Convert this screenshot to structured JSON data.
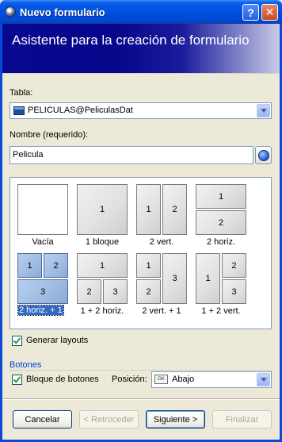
{
  "window": {
    "title": "Nuevo formulario",
    "help_label": "?",
    "close_label": "✕"
  },
  "banner": {
    "text": "Asistente para la creación de formulario"
  },
  "table": {
    "label": "Tabla:",
    "value": "PELICULAS@PeliculasDat",
    "icon": "table-icon"
  },
  "name": {
    "label": "Nombre (requerido):",
    "value": "Pelicula",
    "icon": "globe-icon"
  },
  "layouts": [
    {
      "caption": "Vacía",
      "cells": []
    },
    {
      "caption": "1 bloque",
      "cells": [
        "1"
      ]
    },
    {
      "caption": "2 vert.",
      "cells": [
        "1",
        "2"
      ]
    },
    {
      "caption": "2 horiz.",
      "cells": [
        "1",
        "2"
      ]
    },
    {
      "caption": "2 horiz. + 1",
      "cells": [
        "1",
        "2",
        "3"
      ],
      "selected": true
    },
    {
      "caption": "1 + 2 horiz.",
      "cells": [
        "1",
        "2",
        "3"
      ]
    },
    {
      "caption": "2 vert. + 1",
      "cells": [
        "1",
        "2",
        "3"
      ]
    },
    {
      "caption": "1 + 2 vert.",
      "cells": [
        "1",
        "2",
        "3"
      ]
    }
  ],
  "generate_layouts": {
    "label": "Generar layouts",
    "checked": true
  },
  "buttons_group": {
    "title": "Botones",
    "block_label": "Bloque de botones",
    "block_checked": true,
    "position_label": "Posición:",
    "position_value": "Abajo",
    "position_icon_text": "OK"
  },
  "footer": {
    "cancel": "Cancelar",
    "back": "< Retroceder",
    "next": "Siguiente >",
    "finish": "Finalizar"
  },
  "colors": {
    "title_bar": "#0054e3",
    "selection": "#316ac5",
    "group_title": "#0046d5",
    "banner": "#07088f"
  }
}
